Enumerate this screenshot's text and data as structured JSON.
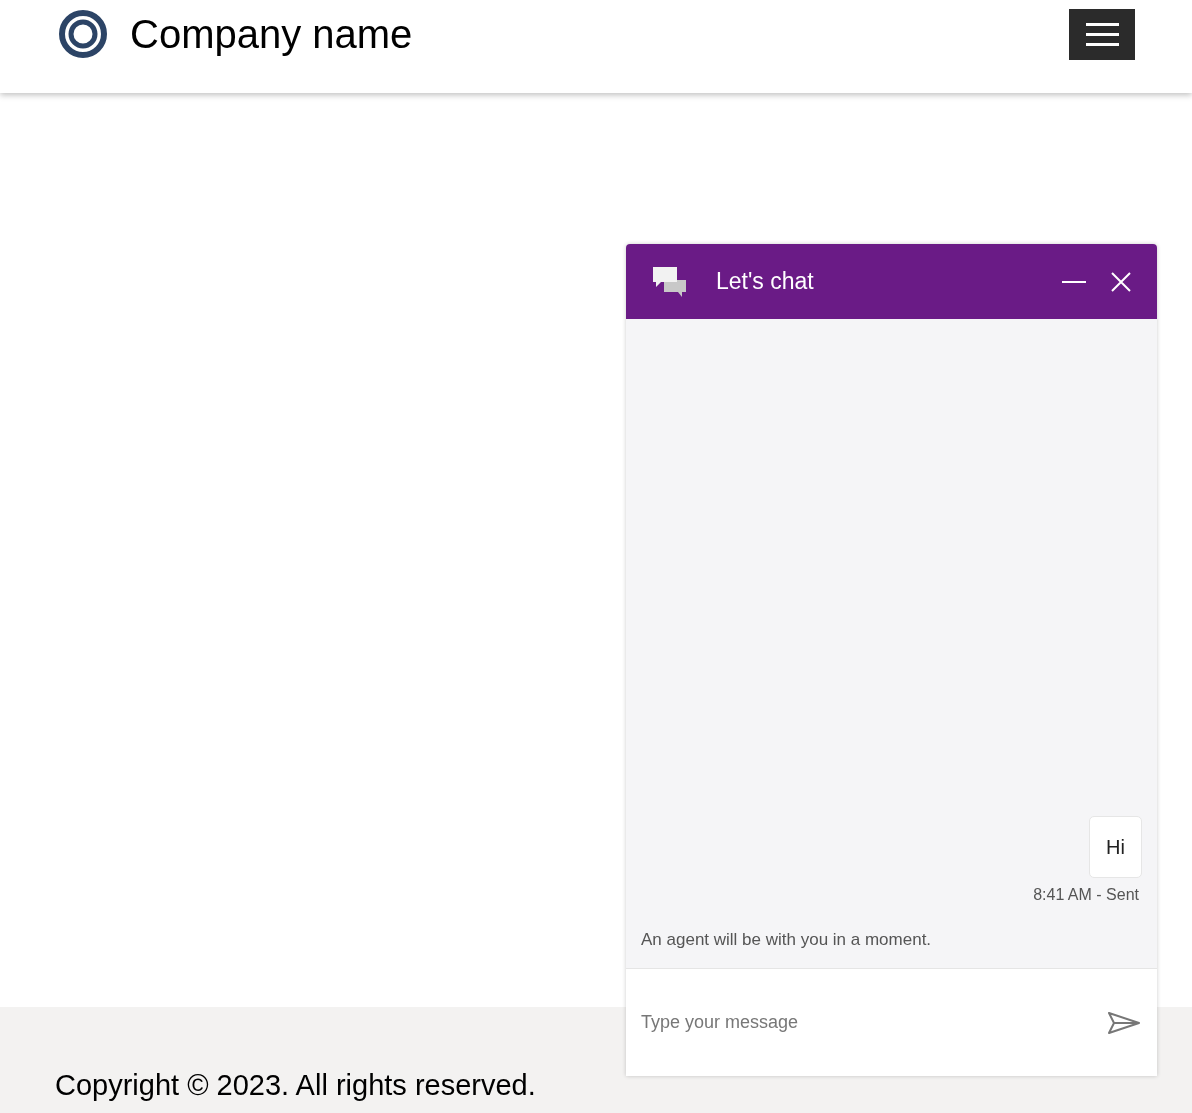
{
  "header": {
    "company_name": "Company name"
  },
  "chat": {
    "title": "Let's chat",
    "messages": [
      {
        "kind": "outgoing",
        "text": "Hi",
        "meta": "8:41 AM - Sent"
      },
      {
        "kind": "system",
        "text": "An agent will be with you in a moment."
      }
    ],
    "input": {
      "placeholder": "Type your message"
    }
  },
  "footer": {
    "copyright": "Copyright © 2023. All rights reserved."
  }
}
